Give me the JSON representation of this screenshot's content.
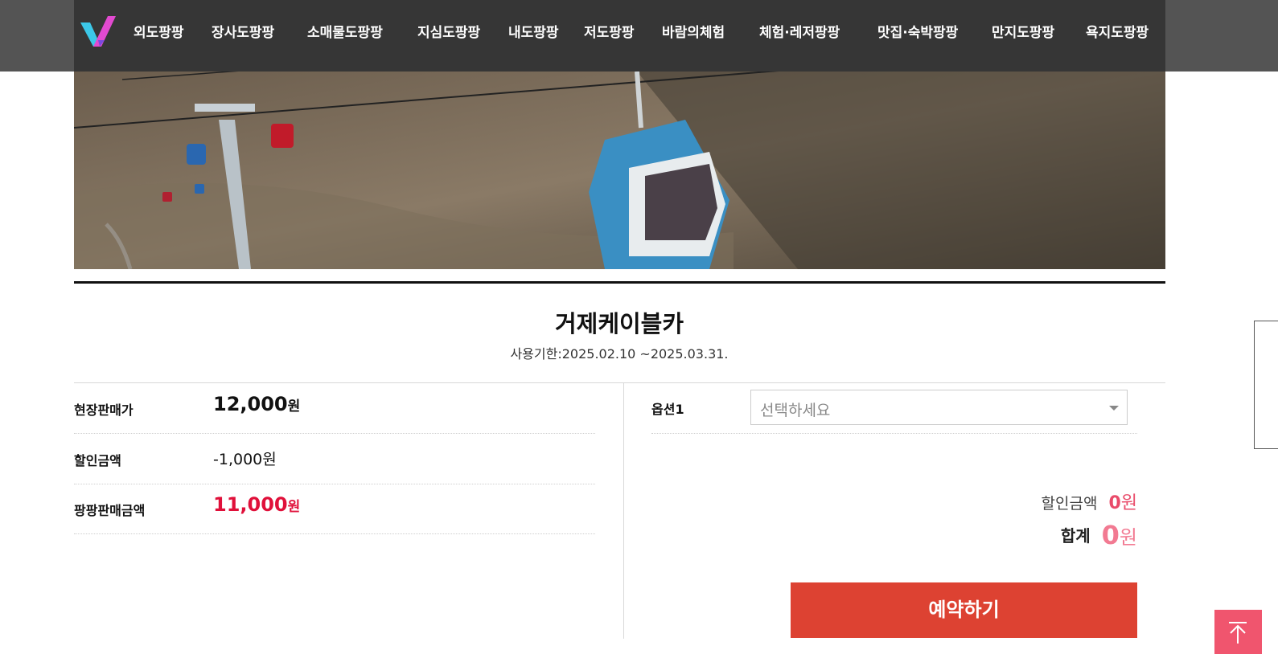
{
  "nav": {
    "logo_icon": "v-logo-icon",
    "items": [
      "외도팡팡",
      "장사도팡팡",
      "소매물도팡팡",
      "지심도팡팡",
      "내도팡팡",
      "저도팡팡",
      "바람의체험",
      "체험·레저팡팡",
      "맛집·숙박팡팡",
      "만지도팡팡",
      "욕지도팡팡"
    ]
  },
  "hero": {
    "image": "cable-car-mountain-photo"
  },
  "product": {
    "title": "거제케이블카",
    "period": "사용기한:2025.02.10 ~2025.03.31."
  },
  "prices": {
    "onsite_label": "현장판매가",
    "onsite_value": "12,000",
    "onsite_unit": "원",
    "discount_label": "할인금액",
    "discount_value": "-1,000원",
    "sale_label": "팡팡판매금액",
    "sale_value": "11,000",
    "sale_unit": "원"
  },
  "option": {
    "label": "옵션1",
    "placeholder": "선택하세요"
  },
  "summary": {
    "discount_label": "할인금액",
    "discount_value": "0",
    "discount_unit": "원",
    "total_label": "합계",
    "total_value": "0",
    "total_unit": "원"
  },
  "actions": {
    "reserve_label": "예약하기",
    "top_icon": "arrow-up-icon"
  },
  "colors": {
    "accent_red": "#dd4232",
    "price_red": "#e0103a",
    "summary_pink": "#f27a92",
    "top_button": "#f0556e"
  }
}
